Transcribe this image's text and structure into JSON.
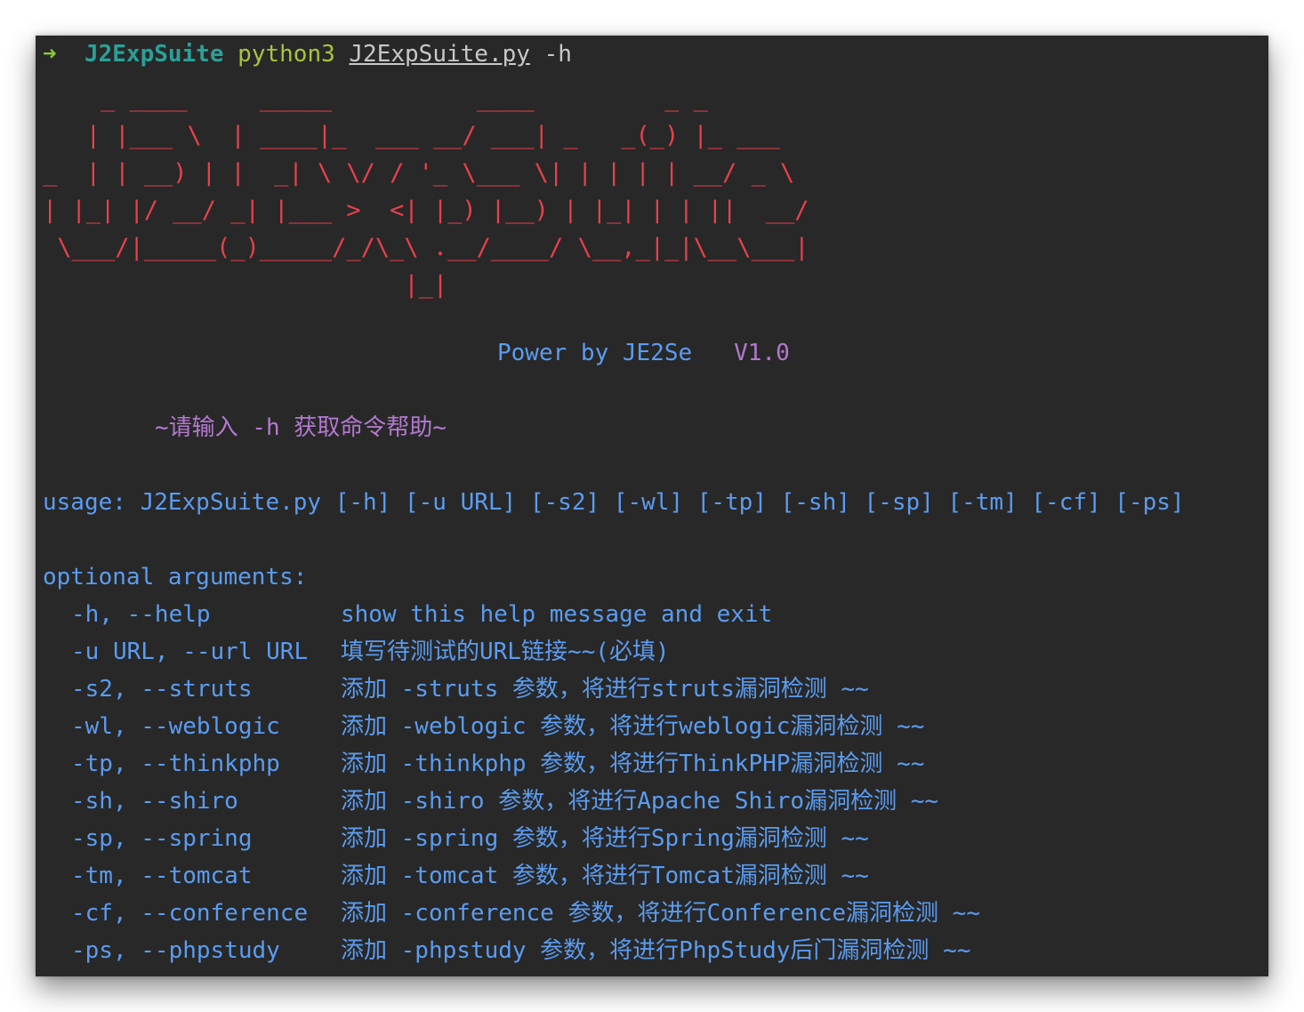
{
  "prompt": {
    "arrow": "➜",
    "directory": "J2ExpSuite",
    "command": "python3",
    "script": "J2ExpSuite.py",
    "flag": "-h"
  },
  "banner": [
    "    _ ____     _____          ____         _ _",
    "   | |___ \\  | ____|_  ___ __/ ___| _   _(_) |_ ___",
    "_  | | __) | |  _| \\ \\/ / '_ \\___ \\| | | | | __/ _ \\",
    "| |_| |/ __/ _| |___ >  <| |_) |__) | |_| | | ||  __/",
    " \\___/|_____(_)_____/_/\\_\\ .__/____/ \\__,_|_|\\__\\___|",
    "                         |_|"
  ],
  "power": {
    "text": "Power by JE2Se",
    "version": "V1.0"
  },
  "hint": "~请输入 -h 获取命令帮助~",
  "usage": "usage: J2ExpSuite.py [-h] [-u URL] [-s2] [-wl] [-tp] [-sh] [-sp] [-tm] [-cf] [-ps]",
  "optional_header": "optional arguments:",
  "arguments": [
    {
      "flag": "-h, --help",
      "desc": "show this help message and exit"
    },
    {
      "flag": "-u URL, --url URL",
      "desc": "填写待测试的URL链接~~(必填)"
    },
    {
      "flag": "-s2, --struts",
      "desc": "添加 -struts 参数，将进行struts漏洞检测 ~~"
    },
    {
      "flag": "-wl, --weblogic",
      "desc": "添加 -weblogic 参数，将进行weblogic漏洞检测 ~~"
    },
    {
      "flag": "-tp, --thinkphp",
      "desc": "添加 -thinkphp 参数，将进行ThinkPHP漏洞检测 ~~"
    },
    {
      "flag": "-sh, --shiro",
      "desc": "添加 -shiro 参数，将进行Apache Shiro漏洞检测 ~~"
    },
    {
      "flag": "-sp, --spring",
      "desc": "添加 -spring 参数，将进行Spring漏洞检测 ~~"
    },
    {
      "flag": "-tm, --tomcat",
      "desc": "添加 -tomcat 参数，将进行Tomcat漏洞检测 ~~"
    },
    {
      "flag": "-cf, --conference",
      "desc": "添加 -conference 参数，将进行Conference漏洞检测 ~~"
    },
    {
      "flag": "-ps, --phpstudy",
      "desc": "添加 -phpstudy 参数，将进行PhpStudy后门漏洞检测 ~~"
    }
  ],
  "colors": {
    "background": "#282828",
    "banner": "#e8414b",
    "help_text": "#5b9cf0",
    "accent": "#b478d0"
  }
}
